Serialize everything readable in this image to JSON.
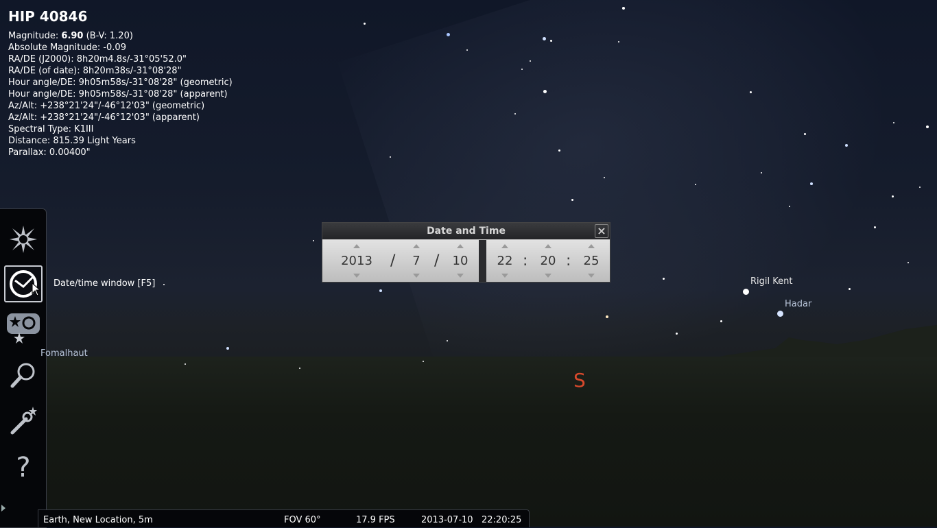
{
  "info": {
    "title": "HIP 40846",
    "magnitude_label": "Magnitude:",
    "magnitude_value": "6.90",
    "magnitude_bv": "(B-V: 1.20)",
    "lines": [
      "Absolute Magnitude: -0.09",
      "RA/DE (J2000): 8h20m4.8s/-31°05'52.0\"",
      "RA/DE (of date): 8h20m38s/-31°08'28\"",
      "Hour angle/DE: 9h05m58s/-31°08'28\" (geometric)",
      "Hour angle/DE: 9h05m58s/-31°08'28\" (apparent)",
      "Az/Alt: +238°21'24\"/-46°12'03\" (geometric)",
      "Az/Alt: +238°21'24\"/-46°12'03\" (apparent)",
      "Spectral Type: K1III",
      "Distance: 815.39 Light Years",
      "Parallax: 0.00400\""
    ]
  },
  "sidebar": {
    "items": [
      {
        "icon": "sky-settings-icon"
      },
      {
        "icon": "clock-icon",
        "active": true
      },
      {
        "icon": "nebula-icon"
      },
      {
        "icon": "search-icon"
      },
      {
        "icon": "wrench-icon"
      },
      {
        "icon": "help-icon"
      }
    ],
    "tooltip": "Date/time window  [F5]"
  },
  "sky_labels": {
    "rigil_kent": "Rigil Kent",
    "hadar": "Hadar",
    "fomalhaut": "Fomalhaut",
    "cardinal_south": "S"
  },
  "datetime_dialog": {
    "title": "Date and Time",
    "close": "×",
    "year": "2013",
    "month": "7",
    "day": "10",
    "hour": "22",
    "minute": "20",
    "second": "25",
    "date_sep": "/",
    "time_sep": ":"
  },
  "statusbar": {
    "location": "Earth, New Location, 5m",
    "fov": "FOV 60°",
    "fps": "17.9 FPS",
    "date": "2013-07-10",
    "time": "22:20:25"
  },
  "colors": {
    "cardinal": "#d8492c",
    "sky": "#151c2c",
    "label_blue": "#b7c4d8"
  }
}
